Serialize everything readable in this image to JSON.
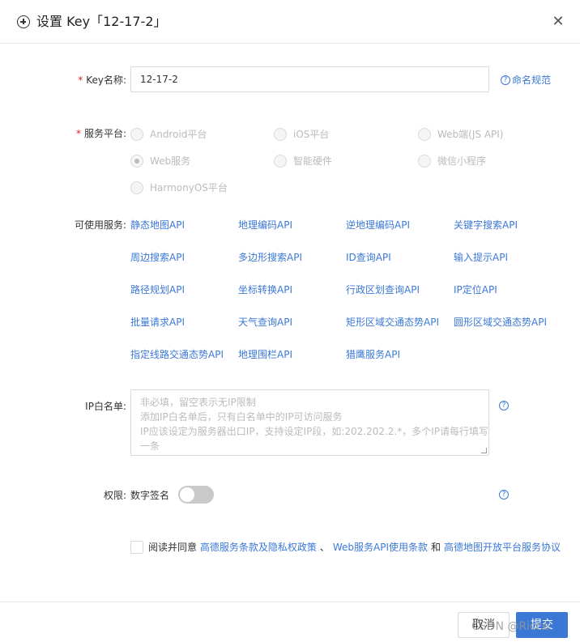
{
  "header": {
    "title": "设置 Key「12-17-2」"
  },
  "key_name": {
    "label": "Key名称:",
    "value": "12-17-2",
    "help": "命名规范"
  },
  "platform": {
    "label": "服务平台:",
    "options": [
      "Android平台",
      "iOS平台",
      "Web端(JS API)",
      "Web服务",
      "智能硬件",
      "微信小程序",
      "HarmonyOS平台"
    ],
    "selected": "Web服务"
  },
  "services": {
    "label": "可使用服务:",
    "items": [
      "静态地图API",
      "地理编码API",
      "逆地理编码API",
      "关键字搜索API",
      "周边搜索API",
      "多边形搜索API",
      "ID查询API",
      "输入提示API",
      "路径规划API",
      "坐标转换API",
      "行政区划查询API",
      "IP定位API",
      "批量请求API",
      "天气查询API",
      "矩形区域交通态势API",
      "圆形区域交通态势API",
      "指定线路交通态势API",
      "地理围栏API",
      "猎鹰服务API"
    ]
  },
  "ip_whitelist": {
    "label": "IP白名单:",
    "placeholder_lines": [
      "非必填，留空表示无IP限制",
      "添加IP白名单后，只有白名单中的IP可访问服务",
      "IP应该设定为服务器出口IP，支持设定IP段，如:202.202.2.*，多个IP请每行填写",
      "一条"
    ]
  },
  "permission": {
    "label": "权限:",
    "option": "数字签名",
    "enabled": false
  },
  "agreement": {
    "prefix": "阅读并同意",
    "link1": "高德服务条款及隐私权政策",
    "sep": "、",
    "link2": "Web服务API使用条款",
    "and": "和",
    "link3": "高德地图开放平台服务协议"
  },
  "footer": {
    "cancel": "取消",
    "submit": "提交"
  },
  "watermark": "CSDN @Ricce",
  "icons": {
    "add": "plus-circle-icon",
    "close": "close-icon",
    "help": "question-circle-icon"
  },
  "colors": {
    "link": "#3b78d6",
    "required": "#e02020",
    "primary": "#3b78d6"
  }
}
